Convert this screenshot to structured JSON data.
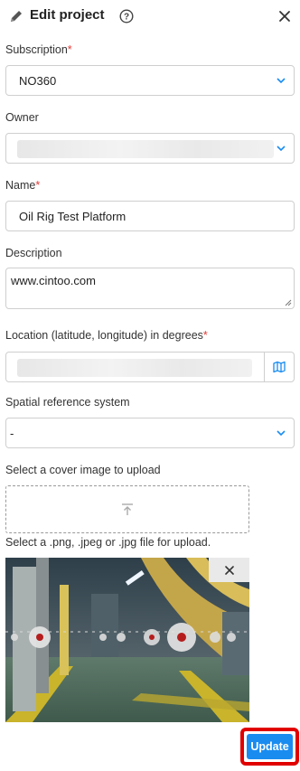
{
  "header": {
    "title": "Edit project",
    "help_icon": "question-circle-icon",
    "close_icon": "close-icon"
  },
  "subscription": {
    "label": "Subscription",
    "required": "*",
    "value": "NO360"
  },
  "owner": {
    "label": "Owner",
    "value": ""
  },
  "name": {
    "label": "Name",
    "required": "*",
    "value": "Oil Rig Test Platform"
  },
  "description": {
    "label": "Description",
    "value": "www.cintoo.com"
  },
  "location": {
    "label": "Location (latitude, longitude) in degrees",
    "required": "*",
    "value": "",
    "map_icon": "map-icon"
  },
  "srs": {
    "label": "Spatial reference system",
    "value": "-"
  },
  "cover": {
    "label": "Select a cover image to upload",
    "upload_icon": "upload-icon",
    "hint": "Select a .png, .jpeg or .jpg file for upload.",
    "remove_icon": "close-icon"
  },
  "footer": {
    "update_label": "Update"
  },
  "colors": {
    "accent": "#1a8cf0",
    "required": "#e53935",
    "highlight": "#e10000"
  }
}
